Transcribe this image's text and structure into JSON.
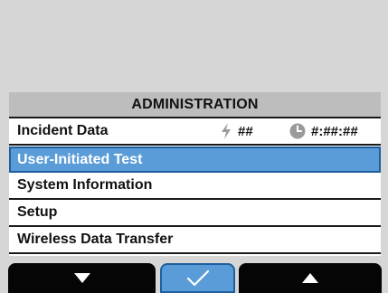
{
  "menu": {
    "title": "ADMINISTRATION",
    "items": [
      {
        "label": "Incident Data",
        "incident_count": "##",
        "incident_time": "#:##:##"
      },
      {
        "label": "User-Initiated Test",
        "selected": true
      },
      {
        "label": "System Information"
      },
      {
        "label": "Setup"
      },
      {
        "label": "Wireless Data Transfer"
      }
    ]
  },
  "softkeys": {
    "left_icon": "down-arrow-icon",
    "center_icon": "checkmark-icon",
    "right_icon": "up-arrow-icon"
  },
  "colors": {
    "background": "#d6d6d6",
    "header": "#bdbdbd",
    "selection": "#5a9cd8",
    "selection_border": "#1e5f9e",
    "softkey": "#050505"
  }
}
